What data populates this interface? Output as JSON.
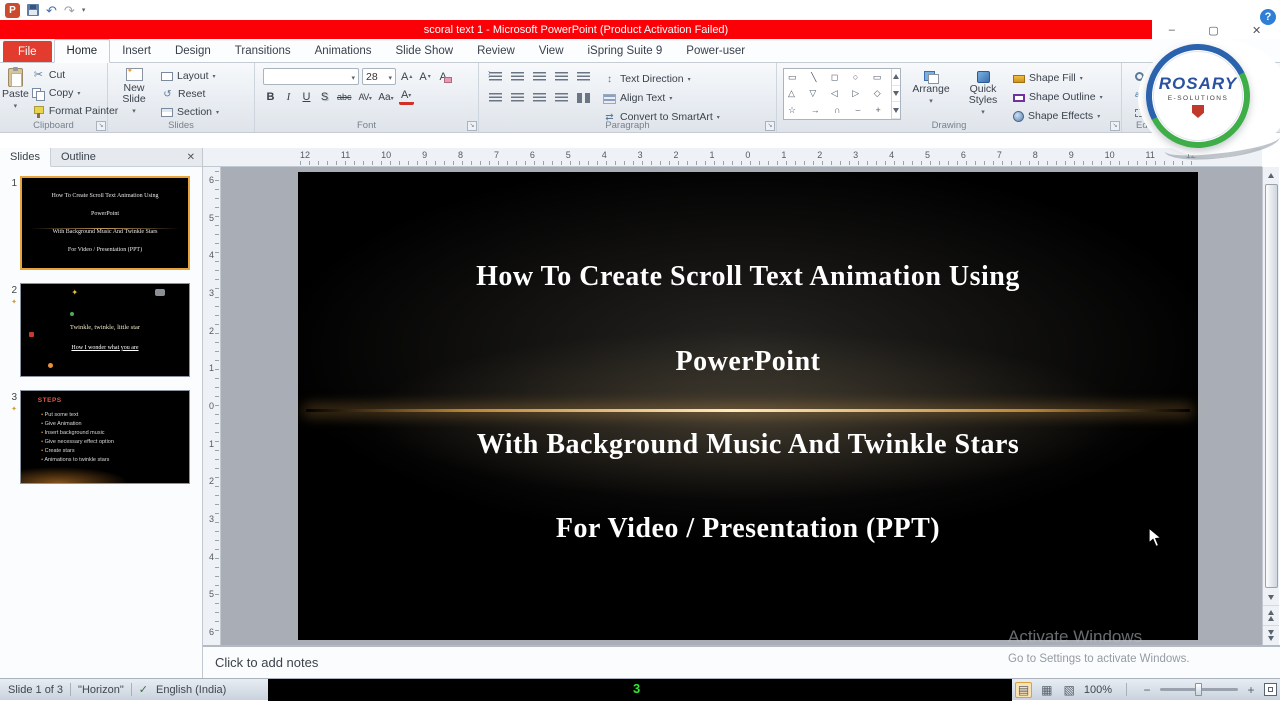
{
  "icons": {
    "undo": "↶",
    "redo": "↷",
    "caret": "▾",
    "scissors": "✂",
    "check": "✓",
    "star": "✦",
    "minus": "−",
    "plus": "+"
  },
  "titlebar": {
    "app_initial": "P",
    "title": "scoral text 1 - Microsoft PowerPoint (Product Activation Failed)",
    "minimize": "–",
    "maximize": "▢",
    "close": "✕",
    "help": "?"
  },
  "tabs": [
    "File",
    "Home",
    "Insert",
    "Design",
    "Transitions",
    "Animations",
    "Slide Show",
    "Review",
    "View",
    "iSpring Suite 9",
    "Power-user"
  ],
  "ribbon": {
    "clipboard": {
      "label": "Clipboard",
      "paste": "Paste",
      "cut": "Cut",
      "copy": "Copy",
      "format_painter": "Format Painter"
    },
    "slides_group": {
      "label": "Slides",
      "new_slide": "New Slide",
      "layout": "Layout",
      "reset": "Reset",
      "section": "Section"
    },
    "font_group": {
      "label": "Font",
      "size": "28",
      "bold": "B",
      "italic": "I",
      "underline": "U",
      "shadow": "S",
      "strike": "abc",
      "spacing": "AV",
      "case_btn": "Aa",
      "color_btn": "A",
      "grow": "A",
      "shrink": "A",
      "clear": "A"
    },
    "paragraph": {
      "label": "Paragraph",
      "text_direction": "Text Direction",
      "align_text": "Align Text",
      "smartart": "Convert to SmartArt"
    },
    "drawing": {
      "label": "Drawing",
      "arrange": "Arrange",
      "quick_styles": "Quick Styles",
      "shape_fill": "Shape Fill",
      "shape_outline": "Shape Outline",
      "shape_effects": "Shape Effects",
      "shapes_row1": "▭ ╲ ◻ ○ ▭",
      "shapes_row2": "△ ▽ ◁ ▷ ◇",
      "shapes_row3": "☆ → ∩ ⌣ +"
    },
    "editing": {
      "label": "Editing",
      "find": "Find",
      "replace": "Repl",
      "select": "Selec"
    }
  },
  "logo": {
    "name": "ROSARY",
    "sub": "E-SOLUTIONS"
  },
  "panel": {
    "slides_tab": "Slides",
    "outline_tab": "Outline",
    "close": "✕"
  },
  "thumbnails": [
    {
      "number": "1",
      "lines": [
        "How To Create  Scroll Text  Animation  Using",
        "PowerPoint",
        "With  Background  Music And Twinkle Stars",
        "For Video / Presentation  (PPT)"
      ]
    },
    {
      "number": "2",
      "line1": "Twinkle, twinkle, little star",
      "line2": "How I wonder what you are"
    },
    {
      "number": "3",
      "heading": "STEPS",
      "bullets": [
        "Put some text",
        "Give Animation",
        "Insert background music",
        "Give necessary effect option",
        "Create stars",
        "Animations to twinkle stars"
      ]
    }
  ],
  "rulers": {
    "horizontal": [
      "12",
      "11",
      "10",
      "9",
      "8",
      "7",
      "6",
      "5",
      "4",
      "3",
      "2",
      "1",
      "0",
      "1",
      "2",
      "3",
      "4",
      "5",
      "6",
      "7",
      "8",
      "9",
      "10",
      "11",
      "12"
    ],
    "vertical": [
      "6",
      "5",
      "4",
      "3",
      "2",
      "1",
      "0",
      "1",
      "2",
      "3",
      "4",
      "5",
      "6"
    ]
  },
  "slide": {
    "line1": "How To Create Scroll Text Animation Using",
    "line2": "PowerPoint",
    "line3": "With Background Music And Twinkle Stars",
    "line4": "For Video / Presentation (PPT)"
  },
  "watermark": {
    "line1": "Activate Windows",
    "line2": "Go to Settings to activate Windows."
  },
  "notes": {
    "placeholder": "Click to add notes"
  },
  "status": {
    "slide": "Slide 1 of 3",
    "theme": "\"Horizon\"",
    "language": "English (India)",
    "marker": "3",
    "zoom": "100%",
    "view_icons": [
      "▤",
      "▦",
      "▧"
    ]
  }
}
